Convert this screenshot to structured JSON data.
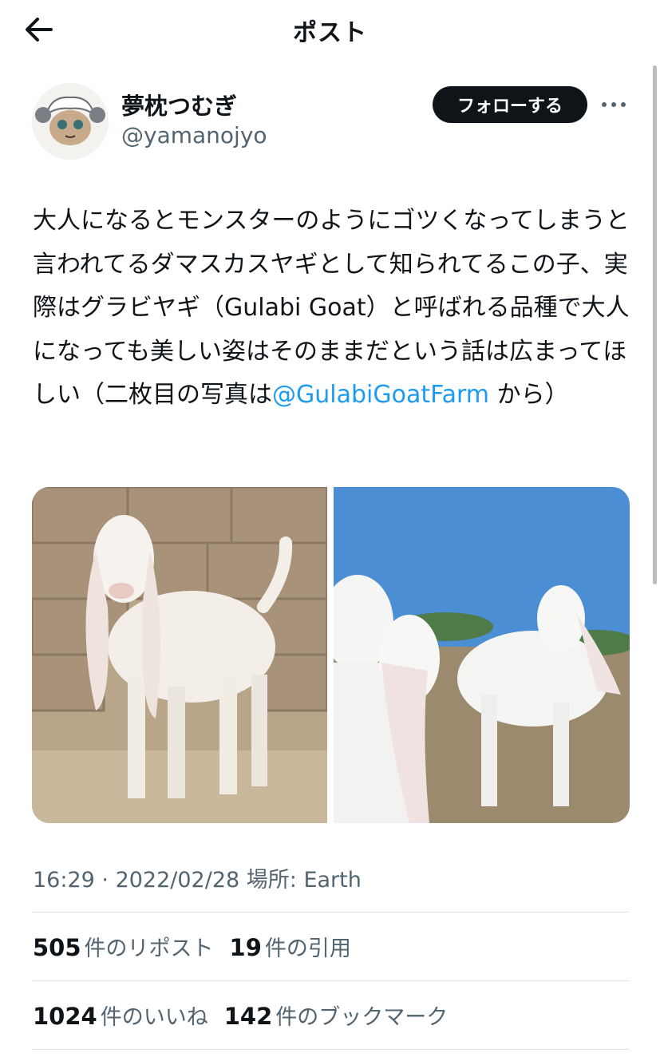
{
  "header": {
    "title": "ポスト",
    "back_icon": "arrow-left-icon"
  },
  "author": {
    "display_name": "夢枕つむぎ",
    "handle": "@yamanojyo",
    "follow_label": "フォローする",
    "more_icon": "more-horizontal-icon"
  },
  "tweet": {
    "text_part1": "大人になるとモンスターのようにゴツくなってしまうと言われてるダマスカスヤギとして知られてるこの子、実際はグラビヤギ（Gulabi Goat）と呼ばれる品種で大人になっても美しい姿はそのままだという話は広まってほしい（二枚目の写真は",
    "mention": "@GulabiGoatFarm",
    "text_part2": " から）"
  },
  "media": [
    "goat-photo-1",
    "goat-photo-2"
  ],
  "meta": {
    "time": "16:29",
    "separator": " · ",
    "date": "2022/02/28",
    "location_label": " 場所: Earth"
  },
  "stats": {
    "reposts": {
      "count": "505",
      "label": "件のリポスト"
    },
    "quotes": {
      "count": "19",
      "label": "件の引用"
    },
    "likes": {
      "count": "1024",
      "label": "件のいいね"
    },
    "bookmarks": {
      "count": "142",
      "label": "件のブックマーク"
    }
  },
  "colors": {
    "accent": "#1d9bf0",
    "text": "#0f1419",
    "muted": "#536471",
    "follow_bg": "#0f1419"
  }
}
